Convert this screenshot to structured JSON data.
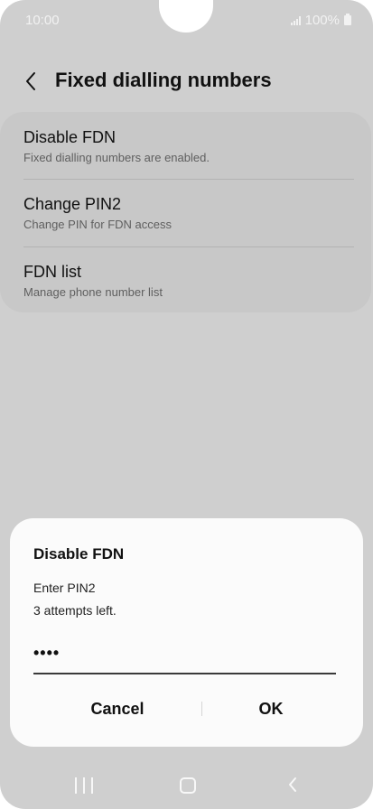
{
  "status_bar": {
    "time": "10:00",
    "battery": "100%"
  },
  "header": {
    "title": "Fixed dialling numbers"
  },
  "list": {
    "items": [
      {
        "title": "Disable FDN",
        "subtitle": "Fixed dialling numbers are enabled."
      },
      {
        "title": "Change PIN2",
        "subtitle": "Change PIN for FDN access"
      },
      {
        "title": "FDN list",
        "subtitle": "Manage phone number list"
      }
    ]
  },
  "dialog": {
    "title": "Disable FDN",
    "line1": "Enter PIN2",
    "line2": "3 attempts left.",
    "pin_value": "••••",
    "cancel_label": "Cancel",
    "ok_label": "OK"
  },
  "colors": {
    "background": "#cfcfcf",
    "dialog": "#fbfbfb",
    "text_primary": "#111111",
    "text_secondary": "#5f5f5f"
  },
  "icons": {
    "back": "chevron-left-icon",
    "signal": "signal-icon",
    "battery": "battery-icon",
    "nav_recents": "recents-icon",
    "nav_home": "home-icon",
    "nav_back": "nav-back-icon"
  }
}
